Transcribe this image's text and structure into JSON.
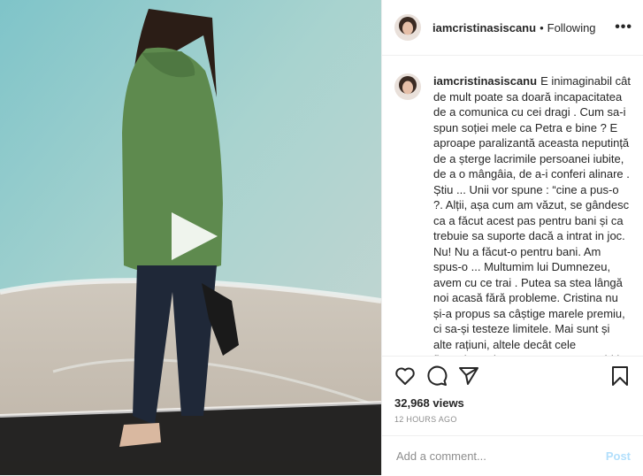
{
  "post": {
    "username": "iamcristinasiscanu",
    "follow_status": "Following",
    "separator": "•",
    "more_label": "•••",
    "caption": "E inimaginabil cât de mult poate sa doară incapacitatea de a comunica cu cei dragi . Cum sa-i spun soției mele ca Petra e bine ? E aproape paralizantă aceasta neputință de a șterge lacrimile persoanei iubite, de a o mângâia, de a-i conferi alinare . Știu ... Unii vor spune : “cine a pus-o ?. Alții, așa cum am văzut, se gândesc ca a făcut acest pas pentru bani și ca trebuie sa suporte dacă a intrat in joc. Nu! Nu a făcut-o pentru bani. Am spus-o ... Multumim lui Dumnezeu, avem cu ce trai . Putea sa stea lângă noi acasă fără probleme. Cristina nu și-a propus sa câștige marele premiu, ci sa-și testeze limitele. Mai sunt și alte rațiuni, altele decât cele financiare, despre care nu pot vorbi in locul ei. Indiferent de motive",
    "views": "32,968 views",
    "time": "12 HOURS AGO"
  },
  "comment_box": {
    "placeholder": "Add a comment...",
    "post_label": "Post"
  },
  "icons": [
    "heart-icon",
    "comment-icon",
    "share-icon",
    "bookmark-icon",
    "play-icon"
  ],
  "colors": {
    "text": "#262626",
    "muted": "#8e8e8e",
    "post_disabled": "#b2dffc",
    "divider": "#efefef",
    "hoodie": "#5e8a4e"
  }
}
